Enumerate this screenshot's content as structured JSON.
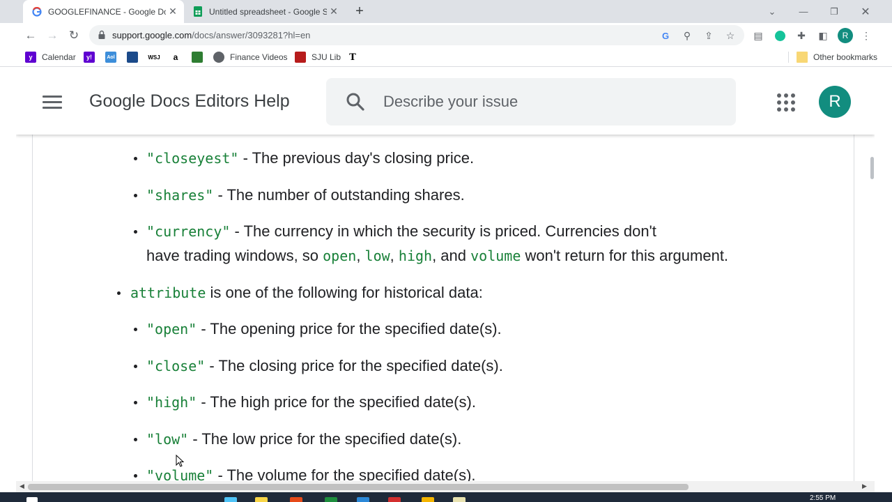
{
  "tabs": [
    {
      "title": "GOOGLEFINANCE - Google Docs",
      "active": true,
      "favicon": "google-g-icon"
    },
    {
      "title": "Untitled spreadsheet - Google Sheets",
      "active": false,
      "favicon": "sheets-icon"
    }
  ],
  "address": {
    "host": "support.google.com",
    "path": "/docs/answer/3093281?hl=en"
  },
  "bookmarks": [
    {
      "label": "Calendar",
      "icon": "yahoo-calendar-icon"
    },
    {
      "label": "",
      "icon": "yahoo-icon"
    },
    {
      "label": "",
      "icon": "aol-icon"
    },
    {
      "label": "",
      "icon": "news-icon"
    },
    {
      "label": "WSJ",
      "icon": "wsj-icon"
    },
    {
      "label": "",
      "icon": "amazon-icon"
    },
    {
      "label": "",
      "icon": "bookmark-icon"
    },
    {
      "label": "Finance Videos",
      "icon": "globe-icon"
    },
    {
      "label": "SJU Lib",
      "icon": "sju-icon"
    },
    {
      "label": "",
      "icon": "nyt-icon"
    }
  ],
  "other_bookmarks": "Other bookmarks",
  "help": {
    "site_title": "Google Docs Editors Help",
    "search_placeholder": "Describe your issue",
    "avatar_letter": "R"
  },
  "profile_letter": "R",
  "article": {
    "closeyest": {
      "code": "\"closeyest\"",
      "text": " - The previous day's closing price."
    },
    "shares": {
      "code": "\"shares\"",
      "text": " - The number of outstanding shares."
    },
    "currency": {
      "code": "\"currency\"",
      "text": " - The currency in which the security is priced. Currencies don't",
      "line2_a": "have trading windows, so ",
      "open": "open",
      "sep1": ", ",
      "low": "low",
      "sep2": ", ",
      "high": "high",
      "sep3": ", and ",
      "volume": "volume",
      "line2_b": " won't return for this argument."
    },
    "attribute": {
      "code": "attribute",
      "text": " is one of the following for historical data:"
    },
    "hist": [
      {
        "code": "\"open\"",
        "text": " - The opening price for the specified date(s)."
      },
      {
        "code": "\"close\"",
        "text": " - The closing price for the specified date(s)."
      },
      {
        "code": "\"high\"",
        "text": " - The high price for the specified date(s)."
      },
      {
        "code": "\"low\"",
        "text": " - The low price for the specified date(s)."
      },
      {
        "code": "\"volume\"",
        "text": " - The volume for the specified date(s)."
      }
    ]
  },
  "taskbar": {
    "time": "2:55 PM"
  },
  "colors": {
    "code": "#188038",
    "avatar": "#128d7f",
    "text": "#202124"
  }
}
